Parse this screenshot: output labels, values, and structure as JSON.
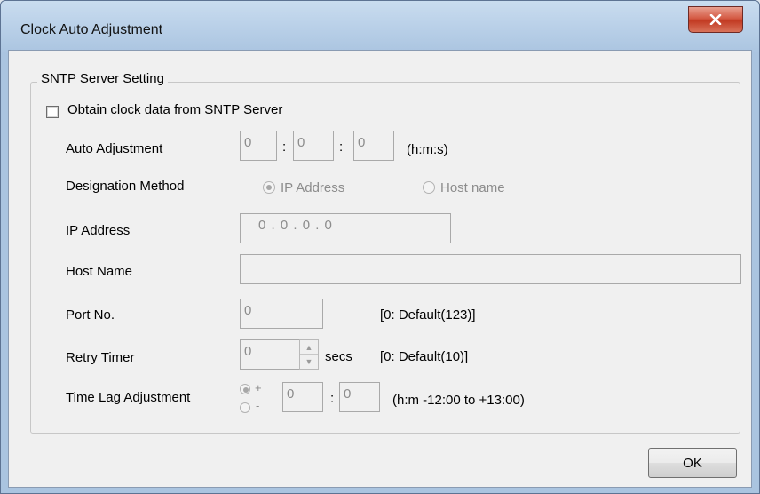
{
  "window": {
    "title": "Clock Auto Adjustment"
  },
  "group": {
    "title": "SNTP Server Setting"
  },
  "obtain": {
    "label": "Obtain clock data from SNTP Server",
    "checked": false
  },
  "auto_adjustment": {
    "label": "Auto Adjustment",
    "h": "0",
    "m": "0",
    "s": "0",
    "colon": ":",
    "unit": "(h:m:s)"
  },
  "designation": {
    "label": "Designation Method",
    "option_ip": "IP Address",
    "option_host": "Host name",
    "selected": "IP Address"
  },
  "ip_address": {
    "label": "IP Address",
    "value": "0 . 0 . 0 . 0"
  },
  "host_name": {
    "label": "Host Name",
    "value": ""
  },
  "port": {
    "label": "Port No.",
    "value": "0",
    "hint": "[0: Default(123)]"
  },
  "retry": {
    "label": "Retry Timer",
    "value": "0",
    "unit": "secs",
    "hint": "[0: Default(10)]"
  },
  "time_lag": {
    "label": "Time Lag Adjustment",
    "plus": "+",
    "minus": "-",
    "h": "0",
    "colon": ":",
    "m": "0",
    "hint": "(h:m  -12:00 to +13:00)"
  },
  "buttons": {
    "ok": "OK"
  }
}
